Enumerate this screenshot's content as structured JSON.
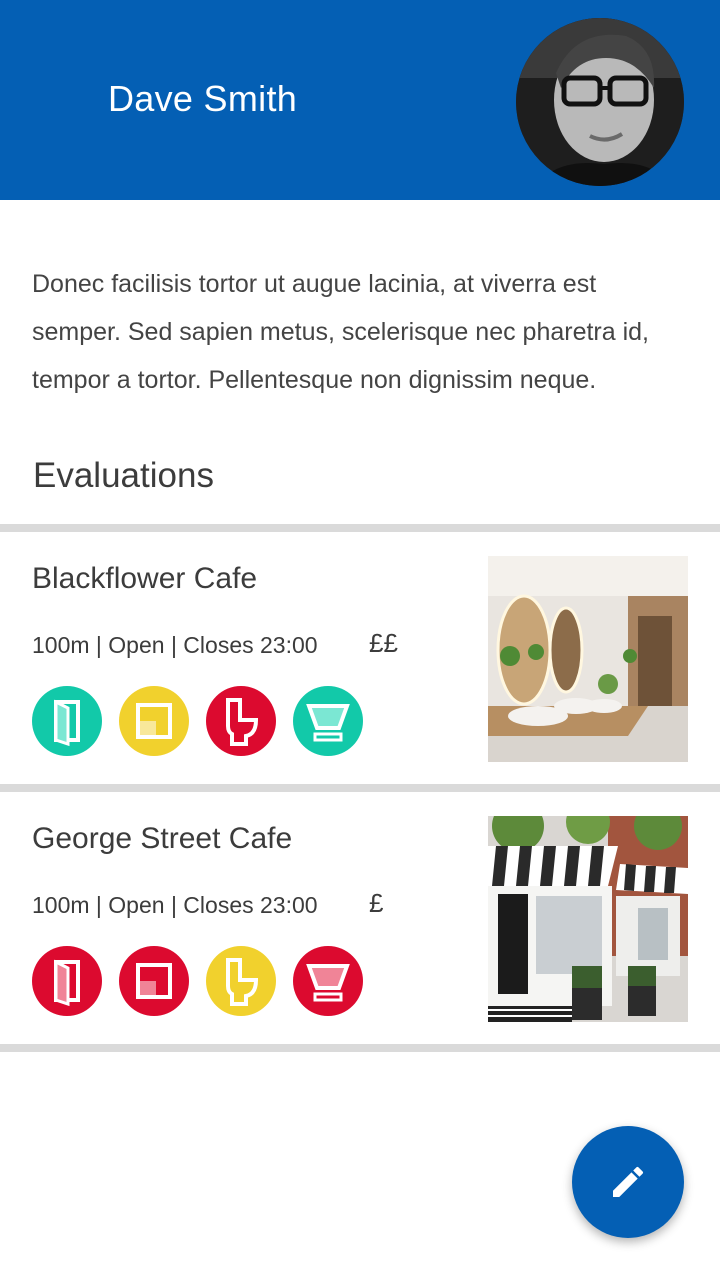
{
  "profile": {
    "name": "Dave Smith",
    "bio": "Donec facilisis tortor ut augue lacinia, at viverra est semper. Sed sapien metus, scelerisque nec pharetra id, tempor a tortor. Pellentesque non dignissim neque."
  },
  "evaluations": {
    "title": "Evaluations",
    "items": [
      {
        "name": "Blackflower Cafe",
        "meta": "100m | Open | Closes 23:00",
        "price": "££",
        "badges": [
          {
            "icon": "door-icon",
            "color": "#12c9a9"
          },
          {
            "icon": "room-icon",
            "color": "#f1d12d"
          },
          {
            "icon": "toilet-icon",
            "color": "#dc0a2f"
          },
          {
            "icon": "cup-icon",
            "color": "#12c9a9"
          }
        ],
        "image": "restroom-photo"
      },
      {
        "name": "George Street Cafe",
        "meta": "100m | Open | Closes 23:00",
        "price": "£",
        "badges": [
          {
            "icon": "door-icon",
            "color": "#dc0a2f"
          },
          {
            "icon": "room-icon",
            "color": "#dc0a2f"
          },
          {
            "icon": "toilet-icon",
            "color": "#f1d12d"
          },
          {
            "icon": "cup-icon",
            "color": "#dc0a2f"
          }
        ],
        "image": "storefront-photo"
      }
    ]
  },
  "fab": {
    "icon": "pencil-icon"
  },
  "colors": {
    "primary": "#045fb4",
    "divider": "#dadada"
  }
}
